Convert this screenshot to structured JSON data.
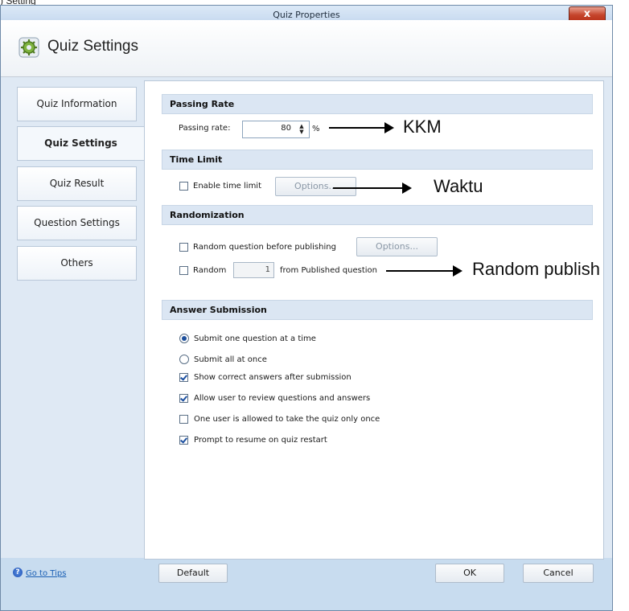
{
  "top_snippet": ") Setting",
  "window": {
    "title": "Quiz Properties",
    "close_label": "x"
  },
  "header": {
    "title": "Quiz Settings",
    "icon": "gear-icon"
  },
  "sidebar": {
    "items": [
      {
        "label": "Quiz Information"
      },
      {
        "label": "Quiz Settings",
        "active": true
      },
      {
        "label": "Quiz Result"
      },
      {
        "label": "Question Settings"
      },
      {
        "label": "Others"
      }
    ]
  },
  "passing_rate": {
    "heading": "Passing  Rate",
    "label": "Passing rate:",
    "value": "80",
    "unit": "%"
  },
  "time_limit": {
    "heading": "Time Limit",
    "enable_label": "Enable time limit",
    "enable_checked": false,
    "options_label": "Options..."
  },
  "randomization": {
    "heading": "Randomization",
    "random_before_label": "Random question before publishing",
    "random_before_checked": false,
    "options_label": "Options...",
    "random_label": "Random",
    "random_checked": false,
    "random_count": "1",
    "random_suffix": "from Published question"
  },
  "answer_submission": {
    "heading": "Answer Submission",
    "radios": [
      {
        "label": "Submit one question at a time",
        "checked": true
      },
      {
        "label": "Submit all at once",
        "checked": false
      }
    ],
    "checkboxes": [
      {
        "label": "Show correct answers after submission",
        "checked": true
      },
      {
        "label": "Allow user to review questions and answers",
        "checked": true
      },
      {
        "label": "One user is allowed to take the quiz only once",
        "checked": false
      },
      {
        "label": "Prompt to resume on quiz restart",
        "checked": true
      }
    ]
  },
  "footer": {
    "tips_label": "Go to Tips",
    "default_label": "Default",
    "ok_label": "OK",
    "cancel_label": "Cancel"
  },
  "annotations": {
    "kkm": "KKM",
    "waktu": "Waktu",
    "random_publish": "Random publish"
  }
}
